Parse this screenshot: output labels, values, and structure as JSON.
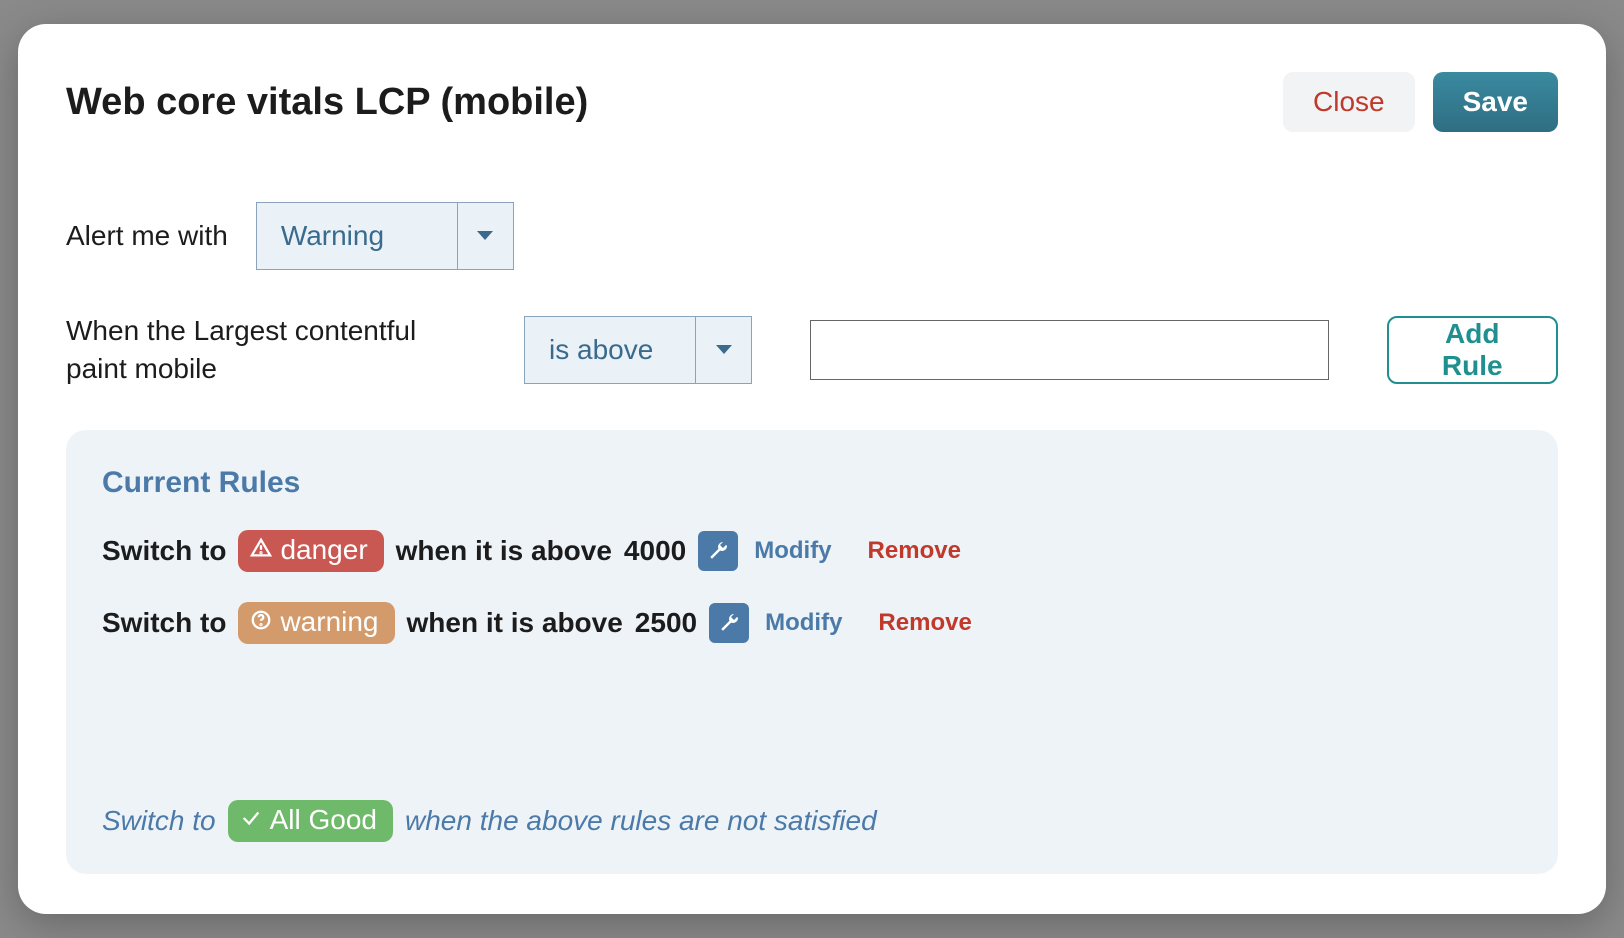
{
  "modal": {
    "title": "Web core vitals LCP (mobile)",
    "close_label": "Close",
    "save_label": "Save"
  },
  "form": {
    "alert_label": "Alert me with",
    "alert_level_selected": "Warning",
    "metric_label": "When the Largest contentful paint mobile",
    "comparator_selected": "is above",
    "threshold_value": "",
    "add_rule_label": "Add Rule"
  },
  "rules": {
    "heading": "Current Rules",
    "switch_prefix": "Switch to",
    "when_prefix": "when it is above",
    "modify_label": "Modify",
    "remove_label": "Remove",
    "items": [
      {
        "level": "danger",
        "threshold": "4000"
      },
      {
        "level": "warning",
        "threshold": "2500"
      }
    ],
    "default": {
      "prefix": "Switch to",
      "level_label": "All Good",
      "suffix": "when the above rules are not satisfied"
    }
  }
}
